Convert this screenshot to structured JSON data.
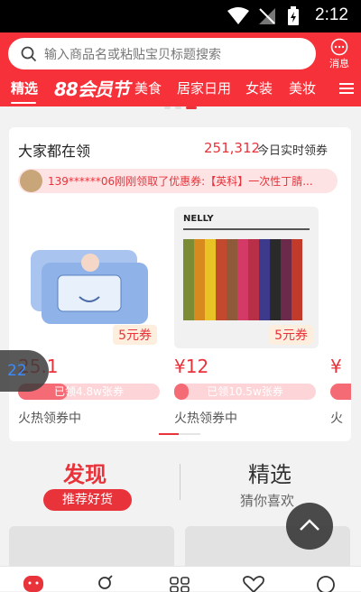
{
  "status_bar": {
    "time": "2:12"
  },
  "header": {
    "search_placeholder": "输入商品名或粘贴宝贝标题搜索",
    "message_label": "消息",
    "tabs": [
      "精选",
      "88会员节",
      "美食",
      "居家日用",
      "女装",
      "美妆"
    ],
    "active_tab": "精选"
  },
  "colors": {
    "brand_red": "#f7313a",
    "accent_red": "#e8333b"
  },
  "card": {
    "title": "大家都在领",
    "count": "251,312",
    "count_label": "今日实时领券",
    "ticker": "139******06刚刚领取了优惠券:【英科】一次性丁腈...",
    "products": [
      {
        "coupon": "5元券",
        "price": "25.1",
        "claimed": "已领4.8w张券",
        "claimed_fraction": 0.35,
        "status": "火热领券中"
      },
      {
        "coupon": "5元券",
        "price": "¥12",
        "claimed": "已领10.5w张券",
        "claimed_fraction": 0.1,
        "status": "火热领券中"
      },
      {
        "price": "¥",
        "status": "火"
      }
    ]
  },
  "float_badge": "22",
  "section2": {
    "left_title": "发现",
    "left_button": "推荐好货",
    "right_title": "精选",
    "right_subtitle": "猜你喜欢"
  },
  "icons": [
    "search-icon",
    "message-icon",
    "menu-icon",
    "back-to-top-icon",
    "home-icon",
    "category-icon",
    "grid-icon",
    "heart-icon",
    "profile-icon"
  ]
}
